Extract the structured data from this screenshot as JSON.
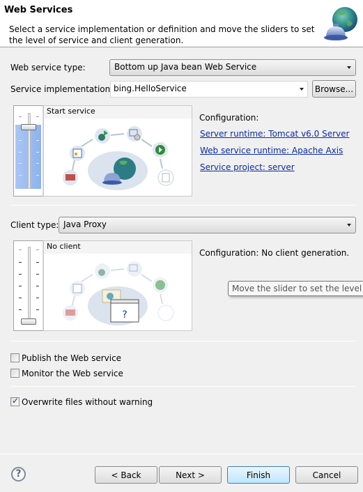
{
  "banner": {
    "title": "Web Services",
    "description": "Select a service implementation or definition and move the sliders to set the level of service and client generation.",
    "icon": "web-service-globe-bell-icon"
  },
  "service": {
    "type_label": "Web service type:",
    "type_value": "Bottom up Java bean Web Service",
    "impl_label": "Service implementation:",
    "impl_value": "bing.HelloService",
    "browse_label": "Browse...",
    "slider_level_label": "Start service",
    "slider_level_fraction": 0.833,
    "configuration_label": "Configuration:",
    "links": [
      "Server runtime: Tomcat v6.0 Server",
      "Web service runtime: Apache Axis",
      "Service project: server"
    ]
  },
  "client": {
    "type_label": "Client type:",
    "type_value": "Java Proxy",
    "slider_level_label": "No client",
    "slider_level_fraction": 0.0,
    "configuration_text": "Configuration: No client generation.",
    "tooltip": "Move the slider to set the level of client generation."
  },
  "options": {
    "publish_label": "Publish the Web service",
    "publish_checked": false,
    "monitor_label": "Monitor the Web service",
    "monitor_checked": false,
    "overwrite_label": "Overwrite files without warning",
    "overwrite_checked": true
  },
  "footer": {
    "help_glyph": "?",
    "back_label": "< Back",
    "next_label": "Next >",
    "finish_label": "Finish",
    "cancel_label": "Cancel"
  },
  "colors": {
    "link": "#0b2ba3",
    "slider_fill": "#8eb2ee",
    "default_button_border": "#3c7fb1"
  }
}
